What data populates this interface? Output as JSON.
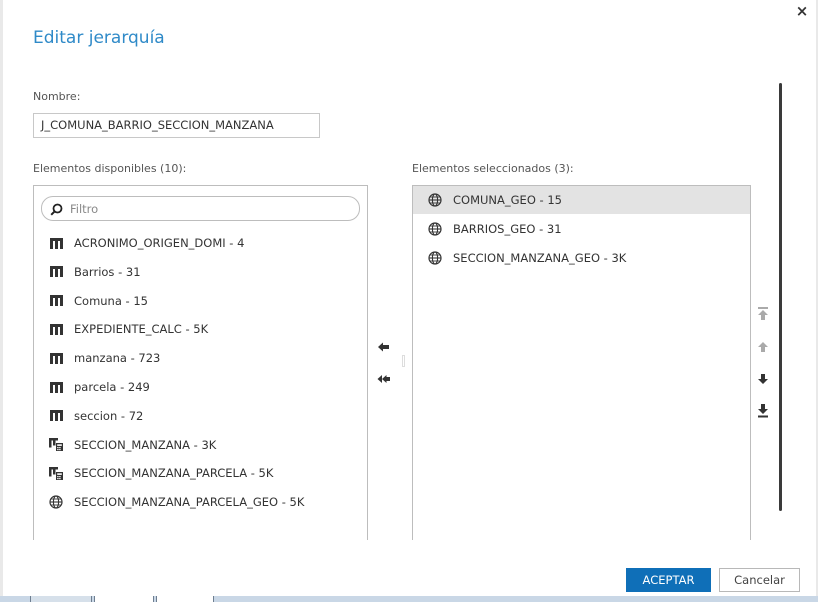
{
  "dialog": {
    "title": "Editar jerarquía",
    "close_glyph": "×",
    "name_label": "Nombre:",
    "name_value": "J_COMUNA_BARRIO_SECCION_MANZANA",
    "available_label": "Elementos disponibles (10):",
    "selected_label": "Elementos seleccionados (3):",
    "filter_placeholder": "Filtro",
    "accept_label": "ACEPTAR",
    "cancel_label": "Cancelar"
  },
  "available_items": [
    {
      "label": "ACRONIMO_ORIGEN_DOMI - 4",
      "icon": "category-icon"
    },
    {
      "label": "Barrios - 31",
      "icon": "category-icon"
    },
    {
      "label": "Comuna - 15",
      "icon": "category-icon"
    },
    {
      "label": "EXPEDIENTE_CALC - 5K",
      "icon": "category-icon"
    },
    {
      "label": "manzana - 723",
      "icon": "category-icon"
    },
    {
      "label": "parcela - 249",
      "icon": "category-icon"
    },
    {
      "label": "seccion - 72",
      "icon": "category-icon"
    },
    {
      "label": "SECCION_MANZANA - 3K",
      "icon": "calculated-category-icon"
    },
    {
      "label": "SECCION_MANZANA_PARCELA - 5K",
      "icon": "calculated-category-icon"
    },
    {
      "label": "SECCION_MANZANA_PARCELA_GEO - 5K",
      "icon": "globe-icon"
    }
  ],
  "selected_items": [
    {
      "label": "COMUNA_GEO - 15",
      "icon": "globe-icon",
      "highlighted": true
    },
    {
      "label": "BARRIOS_GEO - 31",
      "icon": "globe-icon",
      "highlighted": false
    },
    {
      "label": "SECCION_MANZANA_GEO - 3K",
      "icon": "globe-icon",
      "highlighted": false
    }
  ],
  "colors": {
    "title": "#2f8ac8",
    "accept_button": "#0f6fb8",
    "selected_row": "#e3e3e3"
  }
}
